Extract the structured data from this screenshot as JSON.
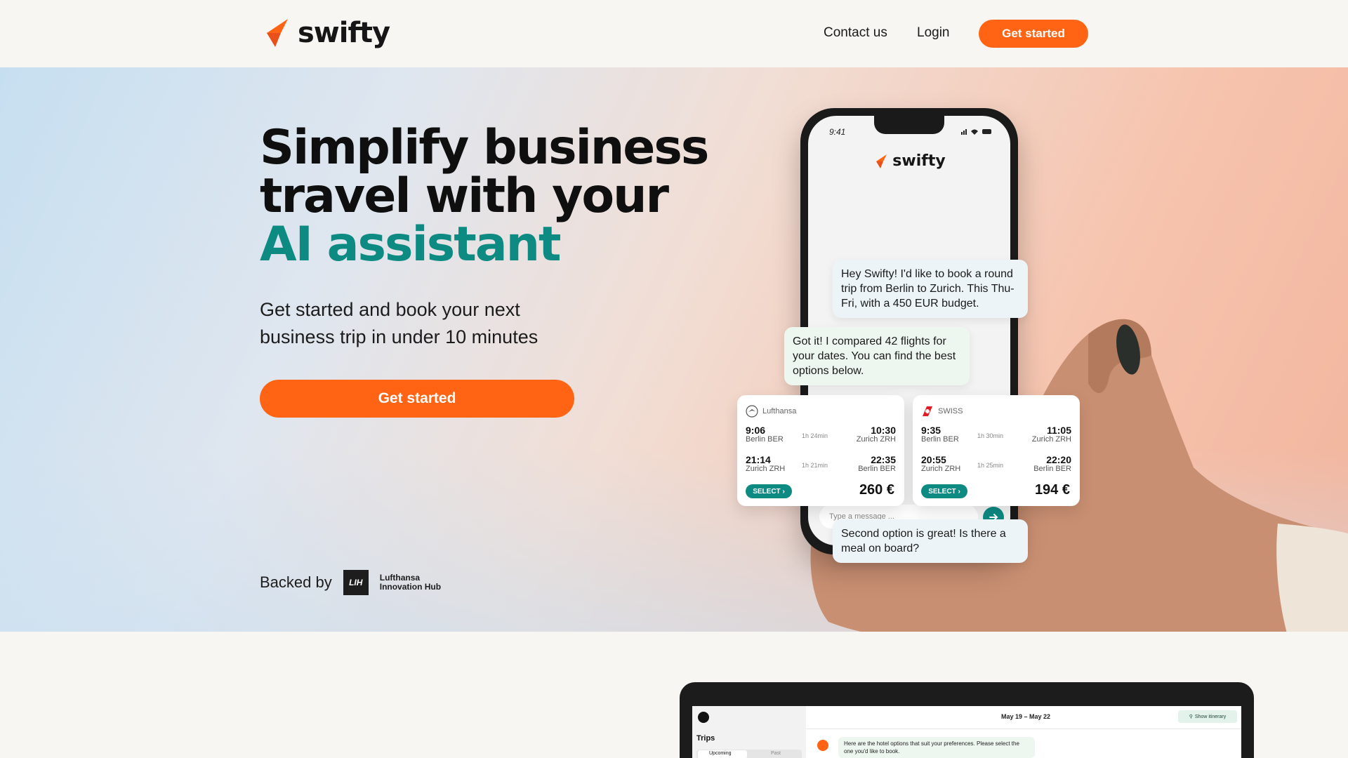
{
  "nav": {
    "brand": "swifty",
    "contact": "Contact us",
    "login": "Login",
    "cta": "Get started"
  },
  "hero": {
    "title_line1": "Simplify business",
    "title_line2": "travel with your",
    "title_accent": "AI assistant",
    "subtitle": "Get started and book your next business trip in under 10 minutes",
    "cta": "Get started",
    "backed_by": "Backed by",
    "backer_short": "LIH",
    "backer_name_line1": "Lufthansa",
    "backer_name_line2": "Innovation Hub"
  },
  "phone": {
    "time": "9:41",
    "brand": "swifty",
    "input_placeholder": "Type a message ...",
    "messages": [
      {
        "from": "user",
        "text": "Hey Swifty! I'd like to book a round trip from Berlin to Zurich. This Thu-Fri, with a 450 EUR budget."
      },
      {
        "from": "ai",
        "text": "Got it! I compared 42 flights for your dates. You can find the best options below."
      },
      {
        "from": "user",
        "text": "Second option is great! Is there a meal on board?"
      }
    ],
    "flights": [
      {
        "airline": "Lufthansa",
        "legs": [
          {
            "dep_time": "9:06",
            "dep_city": "Berlin BER",
            "duration": "1h 24min",
            "arr_time": "10:30",
            "arr_city": "Zurich ZRH"
          },
          {
            "dep_time": "21:14",
            "dep_city": "Zurich ZRH",
            "duration": "1h 21min",
            "arr_time": "22:35",
            "arr_city": "Berlin BER"
          }
        ],
        "select_label": "SELECT",
        "price": "260 €"
      },
      {
        "airline": "SWISS",
        "legs": [
          {
            "dep_time": "9:35",
            "dep_city": "Berlin BER",
            "duration": "1h 30min",
            "arr_time": "11:05",
            "arr_city": "Zurich ZRH"
          },
          {
            "dep_time": "20:55",
            "dep_city": "Zurich ZRH",
            "duration": "1h 25min",
            "arr_time": "22:20",
            "arr_city": "Berlin BER"
          }
        ],
        "select_label": "SELECT",
        "price": "194 €"
      }
    ]
  },
  "laptop": {
    "sidebar_title": "Trips",
    "tab_upcoming": "Upcoming",
    "tab_past": "Past",
    "date_range": "May 19 – May 22",
    "show_itinerary": "Show itinerary",
    "message": "Here are the hotel options that suit your preferences. Please select the one you'd like to book."
  },
  "colors": {
    "accent_orange": "#ff6415",
    "accent_teal": "#0d8a82"
  }
}
